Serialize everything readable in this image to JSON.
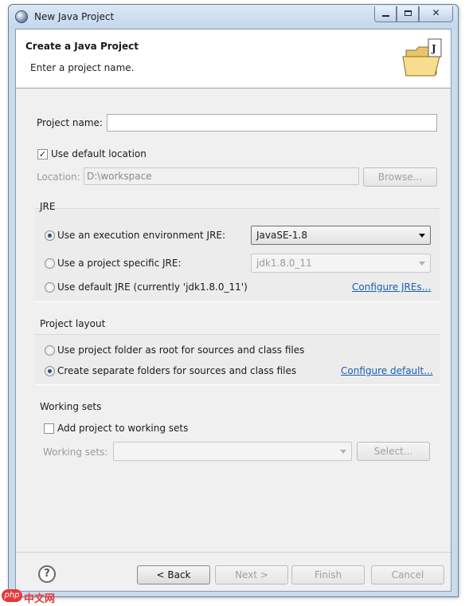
{
  "window": {
    "title": "New Java Project"
  },
  "header": {
    "title": "Create a Java Project",
    "description": "Enter a project name."
  },
  "project": {
    "name_label": "Project name:",
    "name_value": "",
    "use_default_location_label": "Use default location",
    "use_default_location_checked": true,
    "location_label": "Location:",
    "location_value": "D:\\workspace",
    "browse_label": "Browse..."
  },
  "jre": {
    "group_label": "JRE",
    "option_execution_env_label": "Use an execution environment JRE:",
    "execution_env_value": "JavaSE-1.8",
    "option_project_specific_label": "Use a project specific JRE:",
    "project_specific_value": "jdk1.8.0_11",
    "option_default_label": "Use default JRE (currently 'jdk1.8.0_11')",
    "configure_jres_link": "Configure JREs...",
    "selected": "execution_env"
  },
  "layout": {
    "group_label": "Project layout",
    "option_root_label": "Use project folder as root for sources and class files",
    "option_separate_label": "Create separate folders for sources and class files",
    "configure_default_link": "Configure default...",
    "selected": "separate"
  },
  "working_sets": {
    "group_label": "Working sets",
    "add_label": "Add project to working sets",
    "add_checked": false,
    "sets_label": "Working sets:",
    "select_label": "Select..."
  },
  "footer": {
    "back_label": "< Back",
    "next_label": "Next >",
    "finish_label": "Finish",
    "cancel_label": "Cancel"
  },
  "watermark": {
    "logo": "php",
    "text": "中文网"
  },
  "colors": {
    "link": "#1a5fb4",
    "title_bar": "#c9dcee",
    "dialog_bg": "#f0f0f0"
  }
}
